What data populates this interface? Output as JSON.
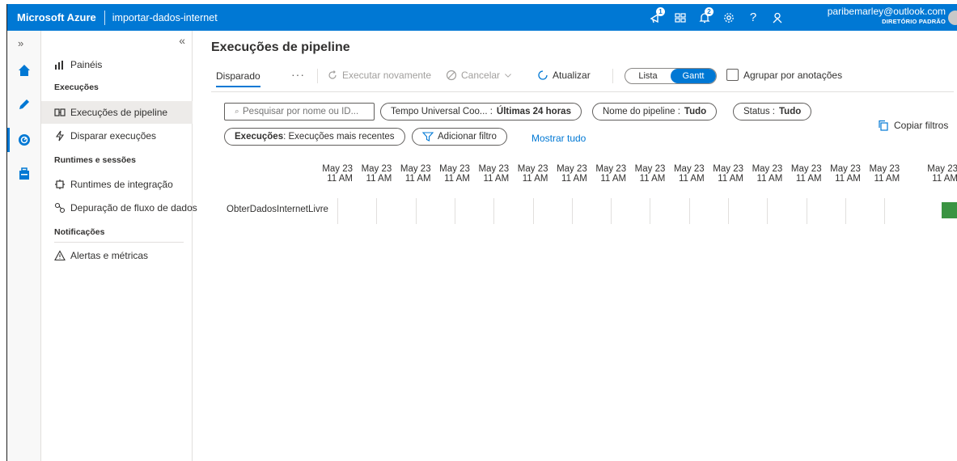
{
  "topbar": {
    "brand": "Microsoft Azure",
    "factory_name": "importar-dados-internet",
    "notifications_count": "1",
    "alerts_count": "2",
    "help": "?",
    "user_email": "paribemarley@outlook.com",
    "user_directory": "DIRETÓRIO PADRÃO"
  },
  "rail": {
    "expand": "»"
  },
  "nav": {
    "collapse": "«",
    "dashboards": "Painéis",
    "section_runs": "Execuções",
    "pipeline_runs": "Execuções de pipeline",
    "trigger_runs": "Disparar execuções",
    "section_runtimes": "Runtimes e sessões",
    "integration_runtimes": "Runtimes de integração",
    "dataflow_debug": "Depuração de fluxo de dados",
    "section_notifications": "Notificações",
    "alerts_metrics": "Alertas e métricas"
  },
  "main": {
    "title": "Execuções de pipeline",
    "tab_triggered": "Disparado",
    "more": "···",
    "rerun": "Executar novamente",
    "cancel": "Cancelar",
    "refresh": "Atualizar",
    "view_list": "Lista",
    "view_gantt": "Gantt",
    "group_by_annotations": "Agrupar por anotações"
  },
  "filters": {
    "search_placeholder": "Pesquisar por nome ou ID...",
    "time_label": "Tempo Universal Coo... : ",
    "time_value": "Últimas 24 horas",
    "pipeline_label": "Nome do pipeline : ",
    "pipeline_value": "Tudo",
    "status_label": "Status : ",
    "status_value": "Tudo",
    "runs_label": "Execuções",
    "runs_value": " : Execuções mais recentes",
    "add_filter": "Adicionar filtro",
    "show_all": "Mostrar tudo",
    "copy_filters": "Copiar filtros"
  },
  "gantt": {
    "ticks": [
      {
        "date": "May 23",
        "time": "11 AM"
      },
      {
        "date": "May 23",
        "time": "11 AM"
      },
      {
        "date": "May 23",
        "time": "11 AM"
      },
      {
        "date": "May 23",
        "time": "11 AM"
      },
      {
        "date": "May 23",
        "time": "11 AM"
      },
      {
        "date": "May 23",
        "time": "11 AM"
      },
      {
        "date": "May 23",
        "time": "11 AM"
      },
      {
        "date": "May 23",
        "time": "11 AM"
      },
      {
        "date": "May 23",
        "time": "11 AM"
      },
      {
        "date": "May 23",
        "time": "11 AM"
      },
      {
        "date": "May 23",
        "time": "11 AM"
      },
      {
        "date": "May 23",
        "time": "11 AM"
      },
      {
        "date": "May 23",
        "time": "11 AM"
      },
      {
        "date": "May 23",
        "time": "11 AM"
      },
      {
        "date": "May 23",
        "time": "11 AM"
      },
      {
        "date": "May 23",
        "time": "11 AM"
      }
    ],
    "rows": [
      {
        "pipeline": "ObterDadosInternetLivre",
        "status_color": "#3a9442"
      }
    ]
  },
  "colors": {
    "accent": "#0078d4",
    "success": "#3a9442"
  }
}
